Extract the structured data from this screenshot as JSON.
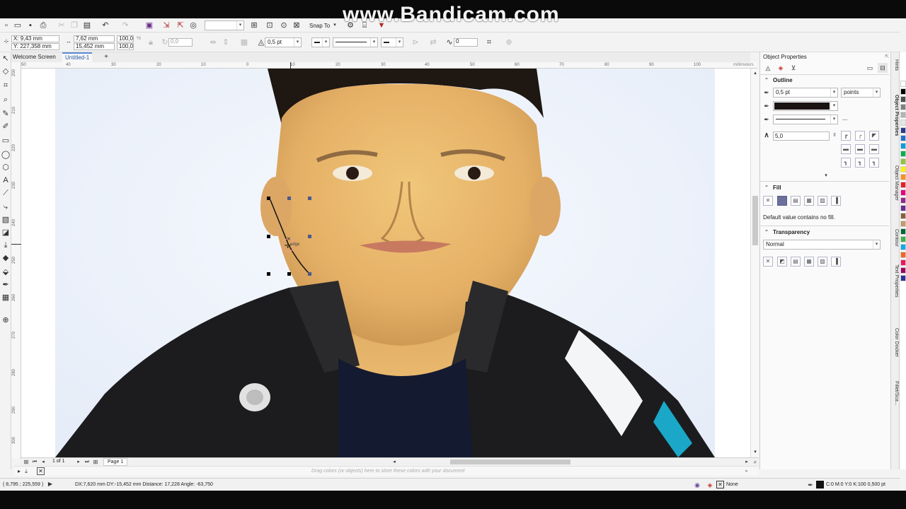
{
  "watermark": "www.Bandicam.com",
  "toolbar": {
    "snap_to": "Snap To"
  },
  "property_bar": {
    "x": "X: 9,43 mm",
    "y": "Y: 227,358 mm",
    "width": "7,62 mm",
    "height": "15,452 mm",
    "scale_w": "100,0",
    "scale_h": "100,0",
    "scale_unit": "%",
    "angle": "0,0",
    "outline_width": "0,5 pt",
    "nodes": "0"
  },
  "tabs": {
    "welcome": "Welcome Screen",
    "document": "Untitled-1"
  },
  "ruler": {
    "unit": "millimeters",
    "h_ticks": [
      "50",
      "40",
      "30",
      "20",
      "10",
      "0",
      "10",
      "20",
      "30",
      "40",
      "50",
      "60",
      "70",
      "80",
      "90",
      "100"
    ],
    "v_ticks": [
      "200",
      "210",
      "220",
      "230",
      "240",
      "250",
      "260",
      "270",
      "280",
      "290",
      "300"
    ]
  },
  "snap_tooltip": "edge",
  "page_nav": {
    "count": "1 of 1",
    "page_tab": "Page 1"
  },
  "color_strip_hint": "Drag colors (or objects) here to store these colors with your document",
  "status": {
    "cursor": "( 8,795 ; 225,559 )",
    "measure": "DX:7,620 mm DY:-15,452 mm Distance: 17,228 Angle: -63,750",
    "fill": "None",
    "outline": "C:0 M:0 Y:0 K:100  0,500 pt"
  },
  "docker": {
    "title": "Object Properties",
    "outline": {
      "title": "Outline",
      "width": "0,5 pt",
      "unit": "points",
      "color": "#1a1412",
      "miter": "5,0",
      "more": "..."
    },
    "fill": {
      "title": "Fill",
      "note": "Default value contains no fill."
    },
    "transparency": {
      "title": "Transparency",
      "mode": "Normal"
    }
  },
  "docker_tabs": [
    "Hints",
    "Object Properties",
    "Object Manager",
    "Contour",
    "Text Properties",
    "Color Docker",
    "Fillet/Sca..."
  ],
  "palette": [
    "#ffffff",
    "#000000",
    "#4d4d4d",
    "#808080",
    "#b3b3b3",
    "#e6e6e6",
    "#2b3a8c",
    "#1f6fd0",
    "#00a0e0",
    "#00b050",
    "#8dc63f",
    "#fff200",
    "#f7941d",
    "#ed1c24",
    "#e6007e",
    "#92278f",
    "#662d91",
    "#8b5e3c",
    "#c49a6c",
    "#006837",
    "#39b54a",
    "#00aeef",
    "#f26522",
    "#ed145b",
    "#9e005d",
    "#2e3192"
  ]
}
